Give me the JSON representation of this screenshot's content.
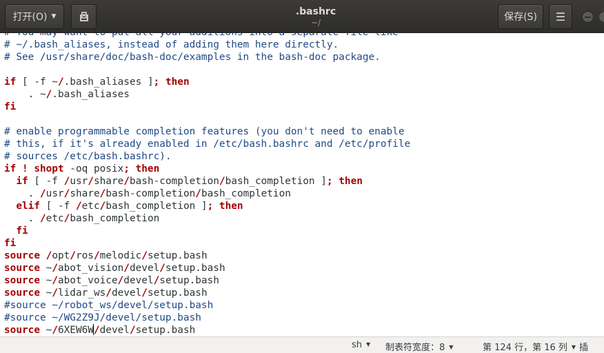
{
  "header": {
    "open_label": "打开(O)",
    "save_label": "保存(S)",
    "title": ".bashrc",
    "subtitle": "~/"
  },
  "editor": {
    "lines": [
      [
        {
          "t": "c",
          "s": "# You may want to put all your additions into a separate file like"
        }
      ],
      [
        {
          "t": "c",
          "s": "# ~/.bash_aliases, instead of adding them here directly."
        }
      ],
      [
        {
          "t": "c",
          "s": "# See /usr/share/doc/bash-doc/examples in the bash-doc package."
        }
      ],
      [],
      [
        {
          "t": "k",
          "s": "if"
        },
        {
          "t": "n",
          "s": " [ -f ~"
        },
        {
          "t": "k",
          "s": "/"
        },
        {
          "t": "n",
          "s": ".bash_aliases ]"
        },
        {
          "t": "k",
          "s": "; then"
        }
      ],
      [
        {
          "t": "n",
          "s": "    . ~"
        },
        {
          "t": "k",
          "s": "/"
        },
        {
          "t": "n",
          "s": ".bash_aliases"
        }
      ],
      [
        {
          "t": "k",
          "s": "fi"
        }
      ],
      [],
      [
        {
          "t": "c",
          "s": "# enable programmable completion features (you don't need to enable"
        }
      ],
      [
        {
          "t": "c",
          "s": "# this, if it's already enabled in /etc/bash.bashrc and /etc/profile"
        }
      ],
      [
        {
          "t": "c",
          "s": "# sources /etc/bash.bashrc)."
        }
      ],
      [
        {
          "t": "k",
          "s": "if ! shopt"
        },
        {
          "t": "n",
          "s": " -oq posix"
        },
        {
          "t": "k",
          "s": "; then"
        }
      ],
      [
        {
          "t": "n",
          "s": "  "
        },
        {
          "t": "k",
          "s": "if"
        },
        {
          "t": "n",
          "s": " [ -f "
        },
        {
          "t": "k",
          "s": "/"
        },
        {
          "t": "n",
          "s": "usr"
        },
        {
          "t": "k",
          "s": "/"
        },
        {
          "t": "n",
          "s": "share"
        },
        {
          "t": "k",
          "s": "/"
        },
        {
          "t": "n",
          "s": "bash-completion"
        },
        {
          "t": "k",
          "s": "/"
        },
        {
          "t": "n",
          "s": "bash_completion ]"
        },
        {
          "t": "k",
          "s": "; then"
        }
      ],
      [
        {
          "t": "n",
          "s": "    . "
        },
        {
          "t": "k",
          "s": "/"
        },
        {
          "t": "n",
          "s": "usr"
        },
        {
          "t": "k",
          "s": "/"
        },
        {
          "t": "n",
          "s": "share"
        },
        {
          "t": "k",
          "s": "/"
        },
        {
          "t": "n",
          "s": "bash-completion"
        },
        {
          "t": "k",
          "s": "/"
        },
        {
          "t": "n",
          "s": "bash_completion"
        }
      ],
      [
        {
          "t": "n",
          "s": "  "
        },
        {
          "t": "k",
          "s": "elif"
        },
        {
          "t": "n",
          "s": " [ -f "
        },
        {
          "t": "k",
          "s": "/"
        },
        {
          "t": "n",
          "s": "etc"
        },
        {
          "t": "k",
          "s": "/"
        },
        {
          "t": "n",
          "s": "bash_completion ]"
        },
        {
          "t": "k",
          "s": "; then"
        }
      ],
      [
        {
          "t": "n",
          "s": "    . "
        },
        {
          "t": "k",
          "s": "/"
        },
        {
          "t": "n",
          "s": "etc"
        },
        {
          "t": "k",
          "s": "/"
        },
        {
          "t": "n",
          "s": "bash_completion"
        }
      ],
      [
        {
          "t": "n",
          "s": "  "
        },
        {
          "t": "k",
          "s": "fi"
        }
      ],
      [
        {
          "t": "k",
          "s": "fi"
        }
      ],
      [
        {
          "t": "k",
          "s": "source /"
        },
        {
          "t": "n",
          "s": "opt"
        },
        {
          "t": "k",
          "s": "/"
        },
        {
          "t": "n",
          "s": "ros"
        },
        {
          "t": "k",
          "s": "/"
        },
        {
          "t": "n",
          "s": "melodic"
        },
        {
          "t": "k",
          "s": "/"
        },
        {
          "t": "n",
          "s": "setup.bash"
        }
      ],
      [
        {
          "t": "k",
          "s": "source"
        },
        {
          "t": "n",
          "s": " ~"
        },
        {
          "t": "k",
          "s": "/"
        },
        {
          "t": "n",
          "s": "abot_vision"
        },
        {
          "t": "k",
          "s": "/"
        },
        {
          "t": "n",
          "s": "devel"
        },
        {
          "t": "k",
          "s": "/"
        },
        {
          "t": "n",
          "s": "setup.bash"
        }
      ],
      [
        {
          "t": "k",
          "s": "source"
        },
        {
          "t": "n",
          "s": " ~"
        },
        {
          "t": "k",
          "s": "/"
        },
        {
          "t": "n",
          "s": "abot_voice"
        },
        {
          "t": "k",
          "s": "/"
        },
        {
          "t": "n",
          "s": "devel"
        },
        {
          "t": "k",
          "s": "/"
        },
        {
          "t": "n",
          "s": "setup.bash"
        }
      ],
      [
        {
          "t": "k",
          "s": "source"
        },
        {
          "t": "n",
          "s": " ~"
        },
        {
          "t": "k",
          "s": "/"
        },
        {
          "t": "n",
          "s": "lidar_ws"
        },
        {
          "t": "k",
          "s": "/"
        },
        {
          "t": "n",
          "s": "devel"
        },
        {
          "t": "k",
          "s": "/"
        },
        {
          "t": "n",
          "s": "setup.bash"
        }
      ],
      [
        {
          "t": "c",
          "s": "#source ~/robot_ws/devel/setup.bash"
        }
      ],
      [
        {
          "t": "c",
          "s": "#source ~/WG2Z9J/devel/setup.bash"
        }
      ],
      [
        {
          "t": "k",
          "s": "source"
        },
        {
          "t": "n",
          "s": " ~"
        },
        {
          "t": "k",
          "s": "/"
        },
        {
          "t": "n",
          "s": "6XEW6W"
        },
        {
          "t": "cur",
          "s": ""
        },
        {
          "t": "k",
          "s": "/"
        },
        {
          "t": "n",
          "s": "devel"
        },
        {
          "t": "k",
          "s": "/"
        },
        {
          "t": "n",
          "s": "setup.bash"
        }
      ]
    ]
  },
  "status": {
    "language": "sh",
    "tab_width": "制表符宽度：8",
    "position": "第 124 行，第 16 列",
    "mode": "插"
  }
}
